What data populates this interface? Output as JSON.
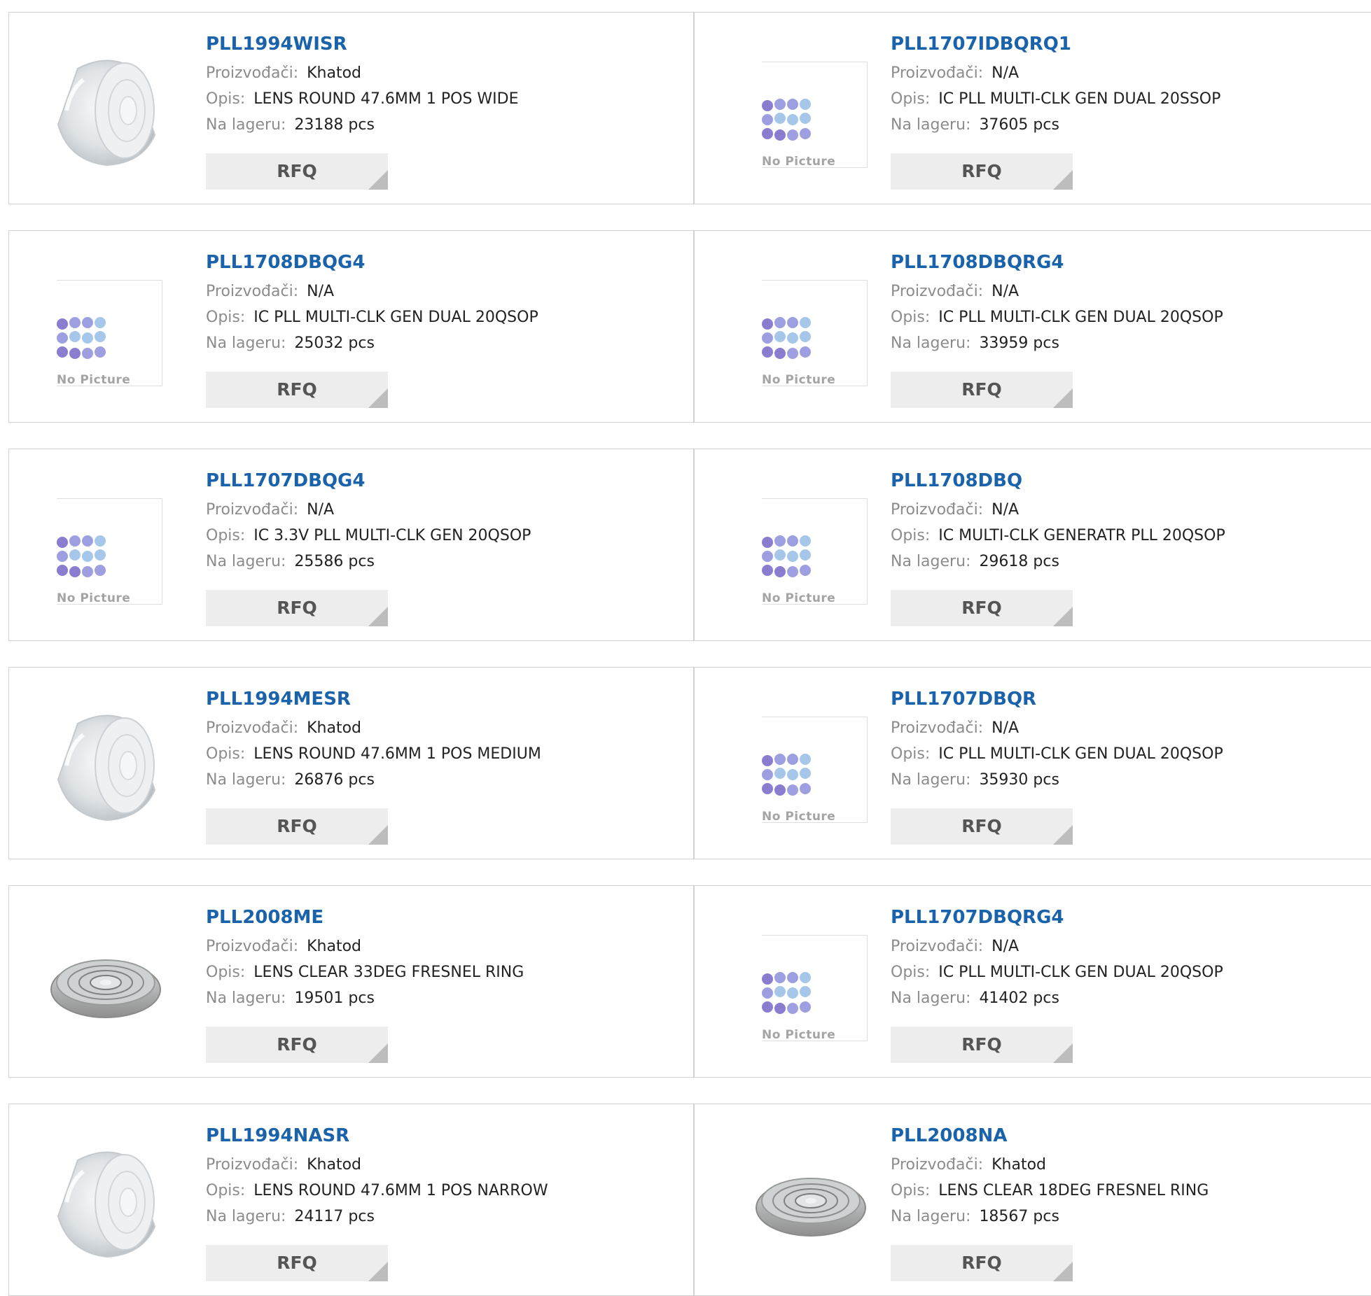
{
  "labels": {
    "manufacturer": "Proizvođači:",
    "description": "Opis:",
    "stock": "Na lageru:",
    "rfq": "RFQ",
    "no_picture": "No Picture"
  },
  "colors": {
    "part_link": "#1a62aa",
    "label_gray": "#8c8c8c",
    "rfq_bg": "#ededed",
    "nopic_dot_light": "#a7c7ea",
    "nopic_dot_mid": "#9d9fe0",
    "nopic_dot_dark": "#8a7dd0"
  },
  "products": [
    {
      "part": "PLL1994WISR",
      "manufacturer": "Khatod",
      "description": "LENS ROUND 47.6MM 1 POS WIDE",
      "stock": "23188 pcs",
      "image": "lens-dome-icon"
    },
    {
      "part": "PLL1707IDBQRQ1",
      "manufacturer": "N/A",
      "description": "IC PLL MULTI-CLK GEN DUAL 20SSOP",
      "stock": "37605 pcs",
      "image": "no-picture-icon"
    },
    {
      "part": "PLL1708DBQG4",
      "manufacturer": "N/A",
      "description": "IC PLL MULTI-CLK GEN DUAL 20QSOP",
      "stock": "25032 pcs",
      "image": "no-picture-icon"
    },
    {
      "part": "PLL1708DBQRG4",
      "manufacturer": "N/A",
      "description": "IC PLL MULTI-CLK GEN DUAL 20QSOP",
      "stock": "33959 pcs",
      "image": "no-picture-icon"
    },
    {
      "part": "PLL1707DBQG4",
      "manufacturer": "N/A",
      "description": "IC 3.3V PLL MULTI-CLK GEN 20QSOP",
      "stock": "25586 pcs",
      "image": "no-picture-icon"
    },
    {
      "part": "PLL1708DBQ",
      "manufacturer": "N/A",
      "description": "IC MULTI-CLK GENERATR PLL 20QSOP",
      "stock": "29618 pcs",
      "image": "no-picture-icon"
    },
    {
      "part": "PLL1994MESR",
      "manufacturer": "Khatod",
      "description": "LENS ROUND 47.6MM 1 POS MEDIUM",
      "stock": "26876 pcs",
      "image": "lens-dome-icon"
    },
    {
      "part": "PLL1707DBQR",
      "manufacturer": "N/A",
      "description": "IC PLL MULTI-CLK GEN DUAL 20QSOP",
      "stock": "35930 pcs",
      "image": "no-picture-icon"
    },
    {
      "part": "PLL2008ME",
      "manufacturer": "Khatod",
      "description": "LENS CLEAR 33DEG FRESNEL RING",
      "stock": "19501 pcs",
      "image": "lens-fresnel-icon"
    },
    {
      "part": "PLL1707DBQRG4",
      "manufacturer": "N/A",
      "description": "IC PLL MULTI-CLK GEN DUAL 20QSOP",
      "stock": "41402 pcs",
      "image": "no-picture-icon"
    },
    {
      "part": "PLL1994NASR",
      "manufacturer": "Khatod",
      "description": "LENS ROUND 47.6MM 1 POS NARROW",
      "stock": "24117 pcs",
      "image": "lens-dome-icon"
    },
    {
      "part": "PLL2008NA",
      "manufacturer": "Khatod",
      "description": "LENS CLEAR 18DEG FRESNEL RING",
      "stock": "18567 pcs",
      "image": "lens-fresnel-icon"
    }
  ]
}
